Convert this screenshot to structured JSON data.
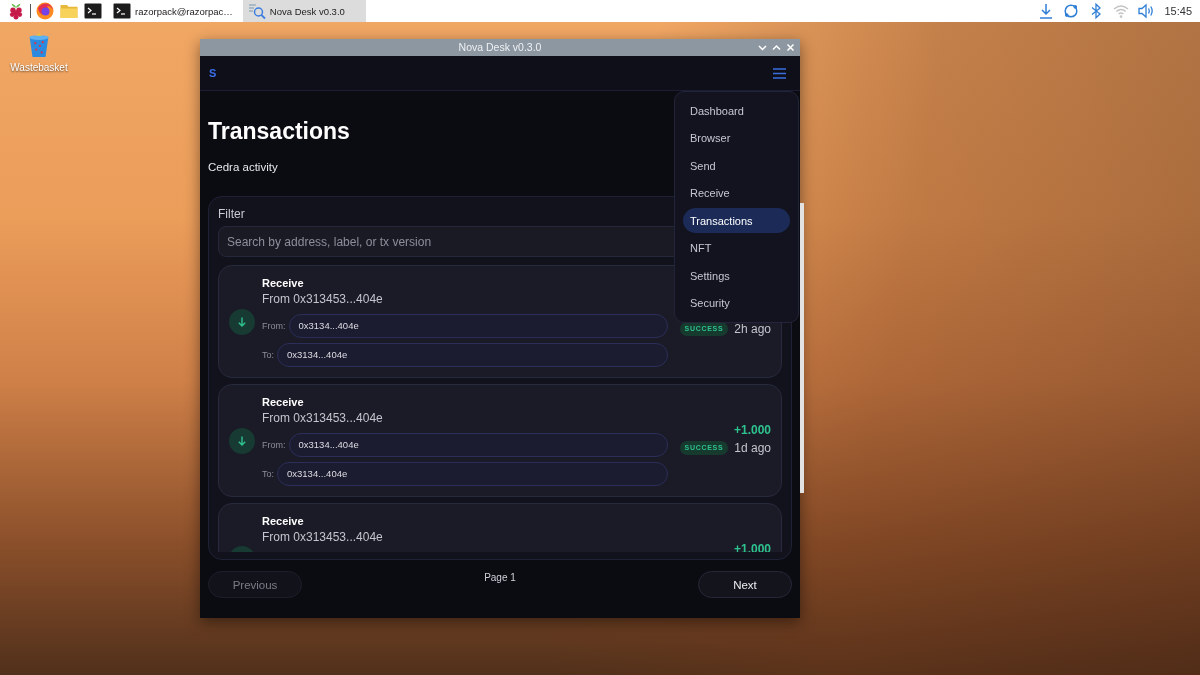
{
  "taskbar": {
    "launchers": [
      {
        "kind": "raspberry"
      },
      {
        "kind": "browser"
      },
      {
        "kind": "folder"
      },
      {
        "kind": "terminal"
      }
    ],
    "windows": [
      {
        "kind": "terminal",
        "label": "razorpack@razorpac…",
        "selected": false
      },
      {
        "kind": "finder",
        "label": "Nova Desk v0.3.0",
        "selected": true
      }
    ],
    "tray": [
      {
        "kind": "download"
      },
      {
        "kind": "sync"
      },
      {
        "kind": "bluetooth"
      },
      {
        "kind": "wifi"
      },
      {
        "kind": "volume"
      }
    ],
    "clock": "15:45"
  },
  "desktop_icons": [
    {
      "kind": "trash",
      "label": "Wastebasket"
    }
  ],
  "window": {
    "title": "Nova Desk v0.3.0",
    "controls": [
      {
        "kind": "minimize"
      },
      {
        "kind": "maximize"
      },
      {
        "kind": "close"
      }
    ]
  },
  "app": {
    "logo": "S",
    "menu": {
      "open": true,
      "items": [
        {
          "label": "Dashboard",
          "selected": false
        },
        {
          "label": "Browser",
          "selected": false
        },
        {
          "label": "Send",
          "selected": false
        },
        {
          "label": "Receive",
          "selected": false
        },
        {
          "label": "Transactions",
          "selected": true
        },
        {
          "label": "NFT",
          "selected": false
        },
        {
          "label": "Settings",
          "selected": false
        },
        {
          "label": "Security",
          "selected": false
        }
      ]
    }
  },
  "page": {
    "title": "Transactions",
    "subtitle": "Cedra activity"
  },
  "filter": {
    "label": "Filter",
    "placeholder": "Search by address, label, or tx version"
  },
  "transactions": [
    {
      "kind": "receive",
      "title": "Receive",
      "summary": "From 0x313453...404e",
      "from_label": "From:",
      "from": "0x3134...404e",
      "to_label": "To:",
      "to": "0x3134...404e",
      "status": {
        "kind": "success",
        "label": "SUCCESS"
      },
      "time": "2h ago"
    },
    {
      "kind": "receive",
      "title": "Receive",
      "summary": "From 0x313453...404e",
      "from_label": "From:",
      "from": "0x3134...404e",
      "to_label": "To:",
      "to": "0x3134...404e",
      "amount": "+1.000",
      "status": {
        "kind": "success",
        "label": "SUCCESS"
      },
      "time": "1d ago"
    },
    {
      "kind": "receive",
      "title": "Receive",
      "summary": "From 0x313453...404e",
      "amount": "+1.000"
    }
  ],
  "pagination": {
    "previous": {
      "label": "Previous",
      "disabled": true
    },
    "page": "Page 1",
    "next": {
      "label": "Next",
      "disabled": false
    }
  }
}
